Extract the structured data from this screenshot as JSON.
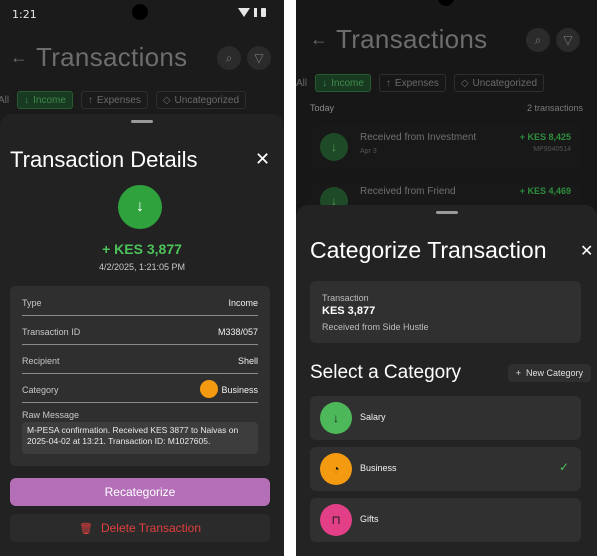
{
  "status": {
    "time": "1:21"
  },
  "left_screen": {
    "header": {
      "title": "Transactions"
    },
    "filters": [
      "All",
      "Income",
      "Expenses",
      "Uncategorized"
    ],
    "details": {
      "title": "Transaction Details",
      "amount": "+ KES 3,877",
      "datetime": "4/2/2025, 1:21:05 PM",
      "rows": [
        {
          "label": "Type",
          "value": "Income"
        },
        {
          "label": "Transaction ID",
          "value": "M338/057"
        },
        {
          "label": "Recipient",
          "value": "Shell"
        },
        {
          "label": "Category",
          "value": "Business"
        }
      ],
      "raw_label": "Raw Message",
      "raw_message": "M-PESA confirmation. Received KES 3877 to Naivas on 2025-04-02 at 13:21. Transaction ID: M1027605.",
      "category_color": "#f39a10",
      "recategorize_label": "Recategorize",
      "delete_label": "Delete Transaction"
    }
  },
  "right_screen": {
    "header": {
      "title": "Transactions"
    },
    "filters": [
      "All",
      "Income",
      "Expenses",
      "Uncategorized"
    ],
    "list": {
      "section": "Today",
      "count": "2 transactions",
      "items": [
        {
          "title": "Received from Investment",
          "date": "Apr 3",
          "amount": "+ KES 8,425",
          "id": "MP9040514"
        },
        {
          "title": "Received from Friend",
          "date": "",
          "amount": "+ KES 4,469",
          "id": ""
        }
      ]
    },
    "categorize": {
      "title": "Categorize Transaction",
      "summary_label": "Transaction",
      "summary_amount": "KES 3,877",
      "summary_desc": "Received from Side Hustle",
      "select_heading": "Select a Category",
      "new_category": "New Category",
      "categories": [
        {
          "name": "Salary",
          "color": "#4cb85a",
          "icon": "arrow-down-icon",
          "selected": false
        },
        {
          "name": "Business",
          "color": "#f39a10",
          "icon": "pie-chart-icon",
          "selected": true
        },
        {
          "name": "Gifts",
          "color": "#e23f86",
          "icon": "bookmark-icon",
          "selected": false
        }
      ]
    }
  },
  "colors": {
    "income_green": "#4cc25b",
    "accent_purple": "#b46fb8",
    "delete_red": "#e0403e"
  }
}
